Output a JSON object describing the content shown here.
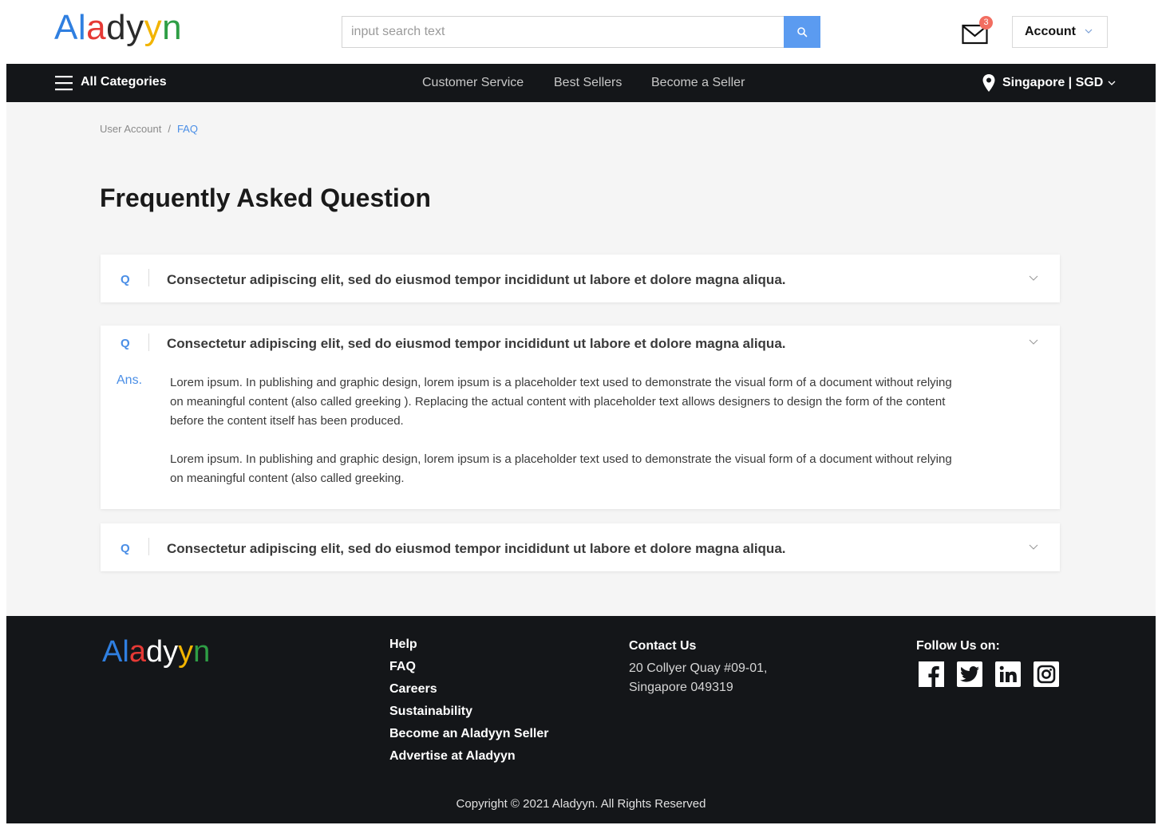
{
  "brand": {
    "logo_letters": [
      {
        "ch": "A",
        "color": "#2f7fe0"
      },
      {
        "ch": "l",
        "color": "#2f7fe0"
      },
      {
        "ch": "a",
        "color": "#e53935"
      },
      {
        "ch": "d",
        "color": "#2b2b2b"
      },
      {
        "ch": "y",
        "color": "#2b2b2b"
      },
      {
        "ch": "y",
        "color": "#f2b400"
      },
      {
        "ch": "n",
        "color": "#2e9e45"
      }
    ],
    "colors": {
      "accent": "#4a8ee6",
      "search_button": "#5b9bf0",
      "badge": "#f26d60",
      "dark": "#141619"
    }
  },
  "header": {
    "search": {
      "placeholder": "input search text",
      "button_icon": "search-icon"
    },
    "mail": {
      "icon": "envelope-icon",
      "badge_count": "3"
    },
    "account": {
      "label": "Account",
      "icon": "chevron-down-icon"
    }
  },
  "nav": {
    "all_categories": "All Categories",
    "links": [
      "Customer Service",
      "Best Sellers",
      "Become a Seller"
    ],
    "location": "Singapore | SGD"
  },
  "breadcrumb": {
    "items": [
      "User Account",
      "FAQ"
    ],
    "separator": "/"
  },
  "page_title": "Frequently Asked Question",
  "faqs": [
    {
      "q_marker": "Q",
      "question": "Consectetur adipiscing elit, sed do eiusmod tempor incididunt ut labore et dolore magna aliqua.",
      "expanded": false
    },
    {
      "q_marker": "Q",
      "question": "Consectetur adipiscing elit, sed do eiusmod tempor incididunt ut labore et dolore magna aliqua.",
      "expanded": true,
      "answer_label": "Ans.",
      "answer_paragraphs": [
        "Lorem ipsum. In publishing and graphic design, lorem ipsum is a placeholder text used to demonstrate the visual form of a document without relying on meaningful content (also called greeking ). Replacing the actual content with placeholder text allows designers to design the form of the content before the content itself has been produced.",
        "Lorem ipsum. In publishing and graphic design, lorem ipsum is a placeholder text used to demonstrate the visual form of a document without relying on meaningful content (also called greeking."
      ]
    },
    {
      "q_marker": "Q",
      "question": "Consectetur adipiscing elit, sed do eiusmod tempor incididunt ut labore et dolore magna aliqua.",
      "expanded": false
    }
  ],
  "footer": {
    "links": [
      "Help",
      "FAQ",
      "Careers",
      "Sustainability",
      "Become an Aladyyn Seller",
      "Advertise at Aladyyn"
    ],
    "contact_title": "Contact Us",
    "contact_address_line1": "20 Collyer Quay #09-01,",
    "contact_address_line2": "Singapore 049319",
    "follow_title": "Follow Us on:",
    "socials": [
      "facebook-icon",
      "twitter-icon",
      "linkedin-icon",
      "instagram-icon"
    ],
    "copyright": "Copyright © 2021 Aladyyn. All Rights Reserved"
  }
}
